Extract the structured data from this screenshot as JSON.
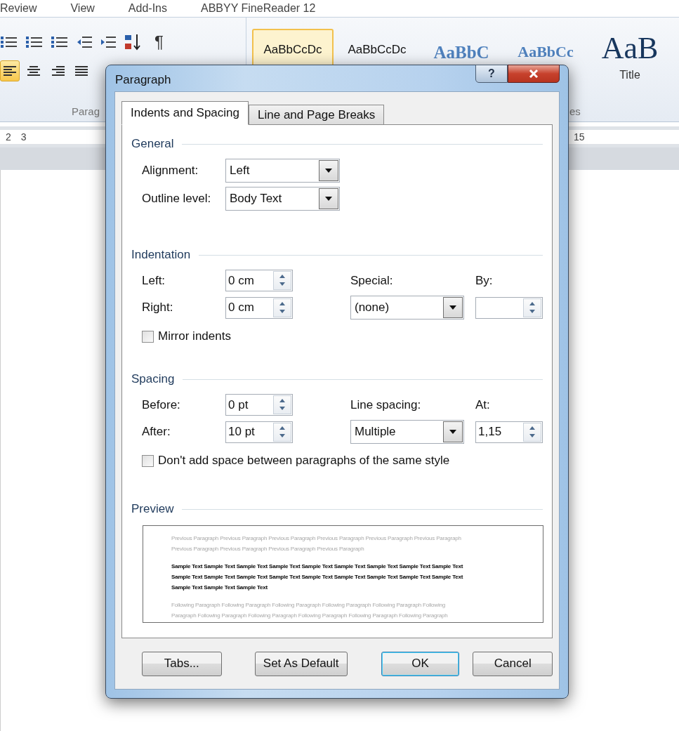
{
  "ribbon": {
    "tabs": [
      "Review",
      "View",
      "Add-Ins",
      "ABBYY FineReader 12"
    ],
    "pilcrow": "¶",
    "align_buttons": [
      {
        "selected": true
      },
      {
        "selected": false
      },
      {
        "selected": false
      },
      {
        "selected": false
      }
    ],
    "styles": [
      {
        "sample": "AaBbCcDc",
        "kind": "normal",
        "selected": true
      },
      {
        "sample": "AaBbCcDc",
        "kind": "normal",
        "selected": false
      },
      {
        "sample": "AaBbC",
        "kind": "heading",
        "selected": false
      },
      {
        "sample": "AaBbCc",
        "kind": "subheading",
        "selected": false
      },
      {
        "sample": "AaB",
        "kind": "title",
        "label": "Title",
        "selected": false
      }
    ],
    "group_labels": [
      "Parag",
      "es"
    ]
  },
  "ruler": {
    "left_numbers": [
      "2",
      "3"
    ],
    "right_numbers": [
      "15"
    ]
  },
  "dialog": {
    "title": "Paragraph",
    "help": "?",
    "tabs": [
      {
        "label": "Indents and Spacing",
        "selected": true
      },
      {
        "label": "Line and Page Breaks",
        "selected": false
      }
    ],
    "general": {
      "heading": "General",
      "alignment": {
        "label": "Alignment:",
        "value": "Left"
      },
      "outline": {
        "label": "Outline level:",
        "value": "Body Text"
      }
    },
    "indentation": {
      "heading": "Indentation",
      "left": {
        "label": "Left:",
        "value": "0 cm"
      },
      "right": {
        "label": "Right:",
        "value": "0 cm"
      },
      "special": {
        "label": "Special:",
        "value": "(none)"
      },
      "by": {
        "label": "By:"
      },
      "mirror": {
        "label": "Mirror indents",
        "checked": false
      }
    },
    "spacing": {
      "heading": "Spacing",
      "before": {
        "label": "Before:",
        "value": "0 pt"
      },
      "after": {
        "label": "After:",
        "value": "10 pt"
      },
      "line_spacing": {
        "label": "Line spacing:",
        "value": "Multiple"
      },
      "at": {
        "label": "At:",
        "value": "1,15"
      },
      "dont_add": {
        "label": "Don't add space between paragraphs of the same style",
        "checked": false
      }
    },
    "preview": {
      "heading": "Preview",
      "previous": [
        "Previous Paragraph Previous Paragraph Previous Paragraph Previous Paragraph Previous Paragraph Previous Paragraph",
        "Previous Paragraph Previous Paragraph Previous Paragraph Previous Paragraph"
      ],
      "sample": [
        "Sample Text Sample Text Sample Text Sample Text Sample Text Sample Text Sample Text Sample Text Sample Text",
        "Sample Text Sample Text Sample Text Sample Text Sample Text Sample Text Sample Text Sample Text Sample Text",
        "Sample Text Sample Text Sample Text"
      ],
      "following": [
        "Following Paragraph Following Paragraph Following Paragraph Following Paragraph Following Paragraph Following",
        "Paragraph Following Paragraph Following Paragraph Following Paragraph Following Paragraph Following Paragraph"
      ]
    },
    "buttons": [
      {
        "label": "Tabs...",
        "default": false
      },
      {
        "label": "Set As Default",
        "default": false
      },
      {
        "label": "OK",
        "default": true
      },
      {
        "label": "Cancel",
        "default": false
      }
    ]
  }
}
